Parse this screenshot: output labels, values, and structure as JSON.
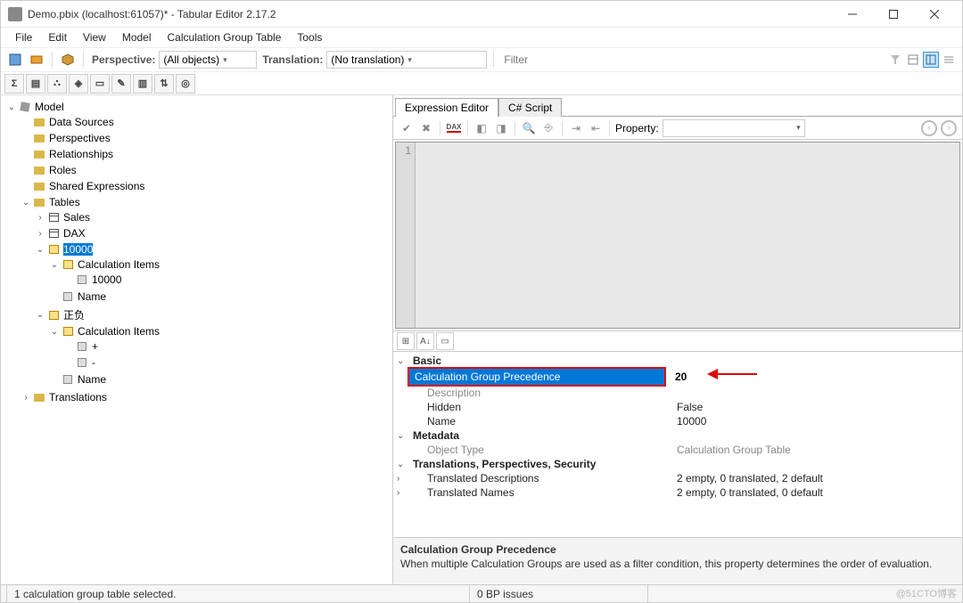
{
  "title": "Demo.pbix (localhost:61057)* - Tabular Editor 2.17.2",
  "menu": [
    "File",
    "Edit",
    "View",
    "Model",
    "Calculation Group Table",
    "Tools"
  ],
  "toolbar1": {
    "perspective_label": "Perspective:",
    "perspective_value": "(All objects)",
    "translation_label": "Translation:",
    "translation_value": "(No translation)",
    "filter_placeholder": "Filter"
  },
  "tree": {
    "root": "Model",
    "data_sources": "Data Sources",
    "perspectives": "Perspectives",
    "relationships": "Relationships",
    "roles": "Roles",
    "shared_expr": "Shared Expressions",
    "tables": "Tables",
    "sales": "Sales",
    "dax": "DAX",
    "g10000": "10000",
    "calc_items": "Calculation Items",
    "i10000": "10000",
    "name_col": "Name",
    "zhengfu": "正负",
    "plus": "+",
    "minus": "-",
    "translations": "Translations"
  },
  "tabs": {
    "expr": "Expression Editor",
    "cs": "C# Script"
  },
  "editor": {
    "property_label": "Property:",
    "line1": "1"
  },
  "props": {
    "cat_basic": "Basic",
    "cgp": "Calculation Group Precedence",
    "cgp_val": "20",
    "description": "Description",
    "hidden": "Hidden",
    "hidden_val": "False",
    "name": "Name",
    "name_val": "10000",
    "cat_meta": "Metadata",
    "obj_type": "Object Type",
    "obj_type_val": "Calculation Group Table",
    "cat_tps": "Translations, Perspectives, Security",
    "tdesc": "Translated Descriptions",
    "tdesc_val": "2 empty, 0 translated, 2 default",
    "tnames": "Translated Names",
    "tnames_val": "2 empty, 0 translated, 0 default"
  },
  "desc": {
    "title": "Calculation Group Precedence",
    "text": "When multiple Calculation Groups are used as a filter condition, this property determines the order of evaluation."
  },
  "status": {
    "left": "1 calculation group table selected.",
    "bp": "0 BP issues"
  },
  "watermark": "@51CTO博客"
}
